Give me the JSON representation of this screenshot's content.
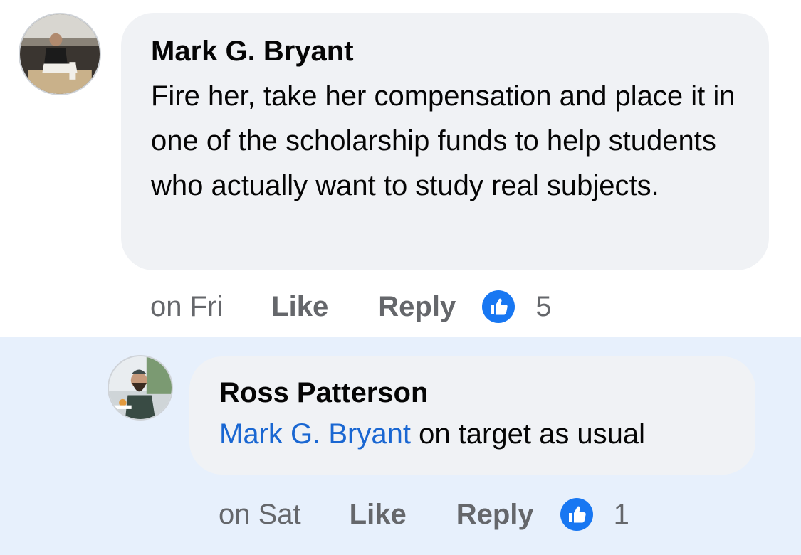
{
  "comments": [
    {
      "author": "Mark G. Bryant",
      "text": "Fire her, take her compensation and place it in one of the scholarship funds to help students who actually want to study real subjects.",
      "time": "on Fri",
      "like_label": "Like",
      "reply_label": "Reply",
      "reaction_icon": "thumbs-up-icon",
      "reaction_count": "5"
    }
  ],
  "replies": [
    {
      "author": "Ross Patterson",
      "mention": "Mark G. Bryant",
      "text": " on target as usual",
      "time": "on Sat",
      "like_label": "Like",
      "reply_label": "Reply",
      "reaction_icon": "thumbs-up-icon",
      "reaction_count": "1"
    }
  ],
  "colors": {
    "bubble": "#f0f2f5",
    "reply_highlight": "#e7f0fc",
    "mention": "#1a67d2",
    "like_blue": "#1877f2",
    "meta_text": "#65676b"
  }
}
